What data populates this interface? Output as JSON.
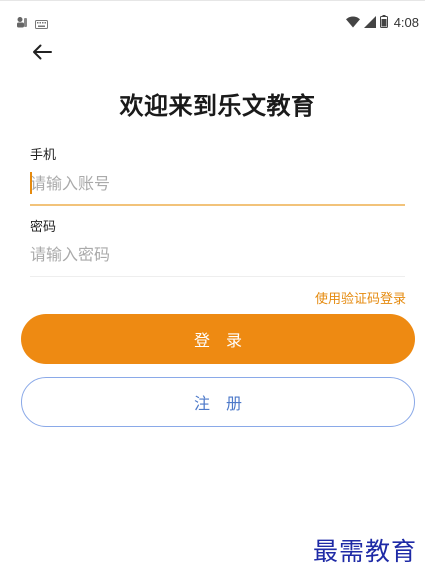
{
  "status_bar": {
    "time": "4:08",
    "icons": [
      "notification-app-icon",
      "keyboard-icon",
      "wifi-icon",
      "signal-icon",
      "battery-icon"
    ]
  },
  "header": {
    "back_icon": "arrow-left-icon",
    "title": "欢迎来到乐文教育"
  },
  "form": {
    "phone": {
      "label": "手机",
      "placeholder": "请输入账号",
      "value": ""
    },
    "password": {
      "label": "密码",
      "placeholder": "请输入密码",
      "value": ""
    },
    "sms_login_link": "使用验证码登录"
  },
  "actions": {
    "login_label": "登录",
    "register_label": "注册"
  },
  "watermark": "最需教育",
  "colors": {
    "accent": "#ee8a12",
    "input_focus_line": "#f2c37a",
    "register_border": "#8aa9e8",
    "register_text": "#4d79c9",
    "watermark": "#1e2aa6"
  }
}
